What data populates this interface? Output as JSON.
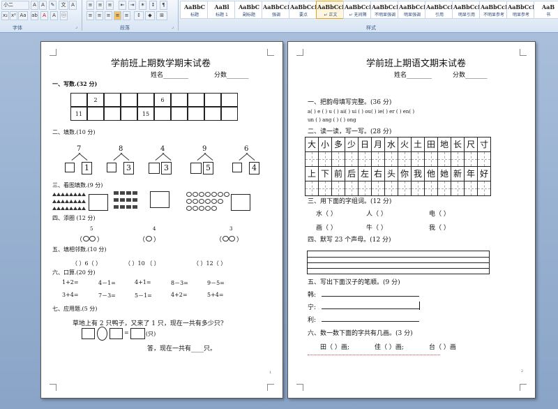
{
  "ribbon": {
    "font_size": "小二",
    "group_font": "字体",
    "group_paragraph": "段落",
    "group_styles": "样式",
    "styles": [
      {
        "sample": "AaBbC",
        "name": "标题"
      },
      {
        "sample": "AaBl",
        "name": "标题 1"
      },
      {
        "sample": "AaBbC",
        "name": "副标题"
      },
      {
        "sample": "AaBbCcD",
        "name": "强调"
      },
      {
        "sample": "AaBbCcD",
        "name": "要点"
      },
      {
        "sample": "AaBbCcD",
        "name": "↵ 正文"
      },
      {
        "sample": "AaBbCcD",
        "name": "↵ 无间隔"
      },
      {
        "sample": "AaBbCcDd",
        "name": "不明显强调"
      },
      {
        "sample": "AaBbCcDc",
        "name": "明显强调"
      },
      {
        "sample": "AaBbCcDd",
        "name": "引用"
      },
      {
        "sample": "AaBbCcDc",
        "name": "明显引用"
      },
      {
        "sample": "AaBbCcDc",
        "name": "不明显参考"
      },
      {
        "sample": "AaBbCcI",
        "name": "明显参考"
      },
      {
        "sample": "AaB",
        "name": "书"
      }
    ]
  },
  "math": {
    "title": "学前班上期数学期末试卷",
    "name_label": "姓名________",
    "score_label": "分数_______",
    "s1": "一、写数.(32 分)",
    "row1": [
      "",
      "2",
      "",
      "",
      "",
      "6",
      "",
      "",
      "",
      ""
    ],
    "row2": [
      "11",
      "",
      "",
      "",
      "15",
      "",
      "",
      "",
      "",
      ""
    ],
    "s2": "二、填数.(10 分)",
    "split_tops": [
      "7",
      "8",
      "4",
      "9",
      "6"
    ],
    "split_given": [
      "1",
      "3",
      "3",
      "5",
      "4"
    ],
    "s3": "三、看图填数.(9 分)",
    "s4": "四、添圈 (12 分)",
    "circle_numbers": [
      "5",
      "4",
      "3"
    ],
    "s5": "五、填相邻数.(10 分)",
    "neighbors": [
      "（   ）6（   ）",
      "（   ）10 （   ）",
      "（   ）12（   ）"
    ],
    "s6": "六、口算.(20 分)",
    "calc_row1": [
      "1+2=",
      "4－1=",
      "4+1=",
      "8－3=",
      "9－5="
    ],
    "calc_row2": [
      "3+4=",
      "7－3=",
      "5－1=",
      "4+2=",
      "5+4="
    ],
    "s7": "七、应用题.(5 分)",
    "problem": "草地上有 2 只鸭子，又来了 1 只，现在一共有多少只?",
    "unit": "(只)",
    "answer": "答，现在一共有____只。",
    "page_no": "1"
  },
  "chinese": {
    "title": "学前班上期语文期末试卷",
    "name_label": "姓名________",
    "score_label": "分数_______",
    "s1": "一、把韵母填写完整。(36 分)",
    "pinyin1": "a(  ) e (  ) u (  ) ai(  ) ui (  ) ou(  ) ie(  ) er (  ) en(  )",
    "pinyin2": "un (  ) ang (  ) (  ) ong",
    "s2": "二、读一读，写一写。(28 分)",
    "chars1": [
      "大",
      "小",
      "多",
      "少",
      "日",
      "月",
      "水",
      "火",
      "土",
      "田",
      "地",
      "长",
      "尺",
      "寸"
    ],
    "chars2": [
      "上",
      "下",
      "前",
      "后",
      "左",
      "右",
      "头",
      "你",
      "我",
      "他",
      "她",
      "新",
      "年",
      "好"
    ],
    "s3": "三、用下面的字组词。(12 分)",
    "words1": [
      "水（      ）",
      "人（      ）",
      "电（      ）"
    ],
    "words2": [
      "画（      ）",
      "牛（      ）",
      "我（      ）"
    ],
    "s4": "四、默写 23 个声母。(12 分)",
    "s5": "五、写出下面汉子的笔顺。(9 分)",
    "stroke_chars": [
      "韩:",
      "宁:",
      "利:"
    ],
    "s6": "六、数一数下面的字共有几画。(3 分)",
    "count_chars": [
      "田（  ）画;",
      "佳（  ）画;",
      "台（  ）画"
    ],
    "page_no": "2"
  }
}
